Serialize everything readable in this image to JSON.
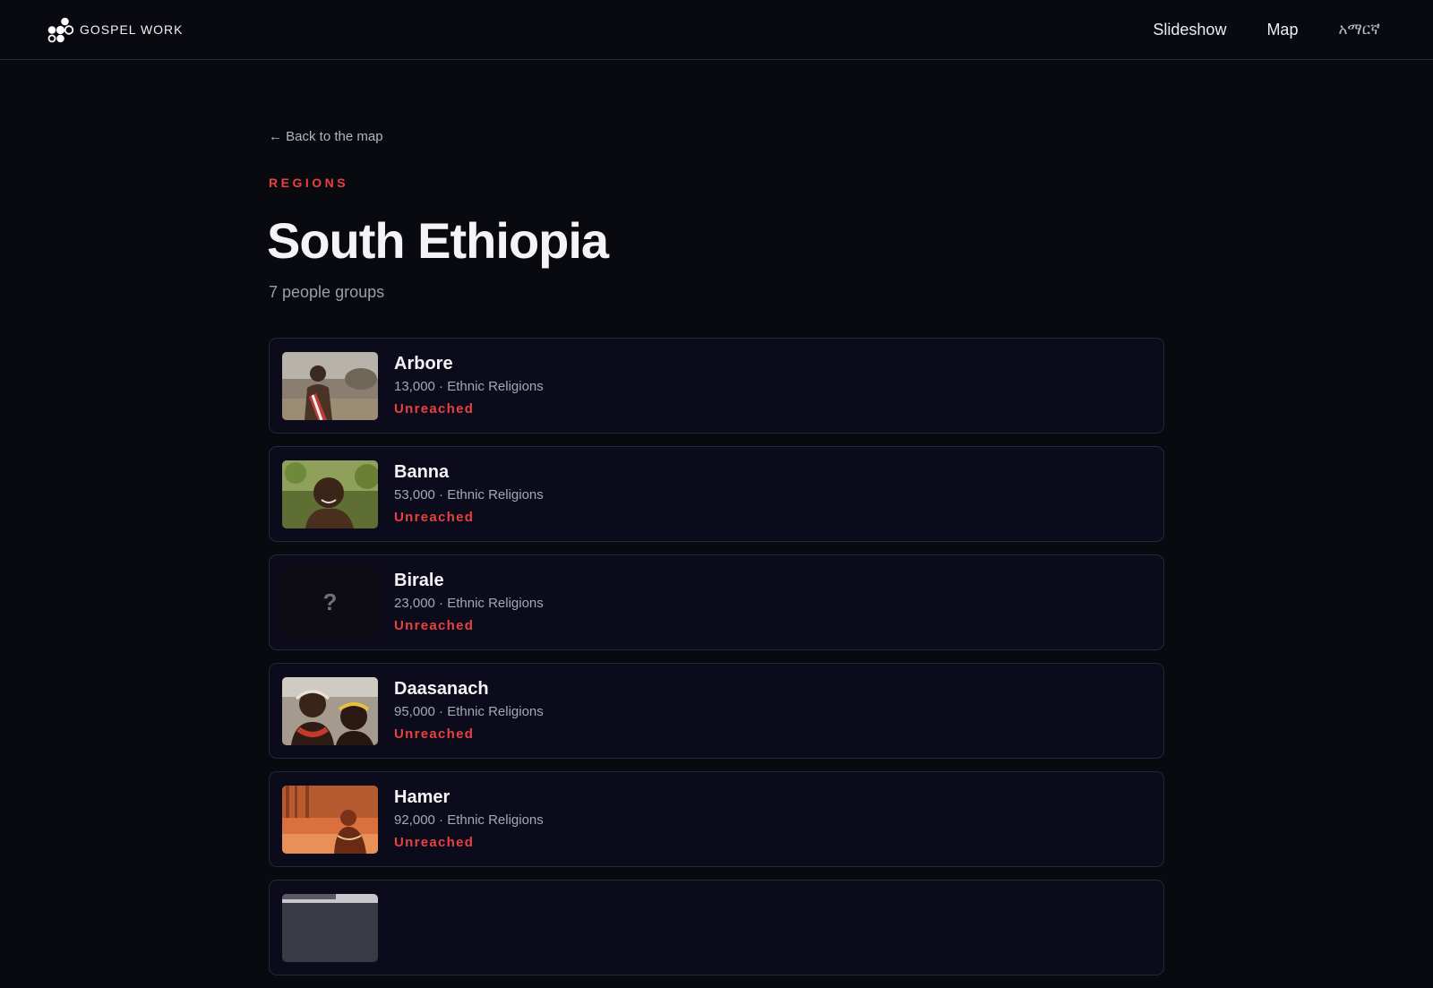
{
  "header": {
    "brand": "GOSPEL WORK",
    "nav": [
      {
        "label": "Slideshow"
      },
      {
        "label": "Map"
      },
      {
        "label": "አማርኛ"
      }
    ]
  },
  "main": {
    "back_label": "← Back to the map",
    "eyebrow": "REGIONS",
    "title": "South Ethiopia",
    "count": "7 people groups",
    "groups": [
      {
        "name": "Arbore",
        "meta": "13,000 · Ethnic Religions",
        "status": "Unreached",
        "has_photo": true
      },
      {
        "name": "Banna",
        "meta": "53,000 · Ethnic Religions",
        "status": "Unreached",
        "has_photo": true
      },
      {
        "name": "Birale",
        "meta": "23,000 · Ethnic Religions",
        "status": "Unreached",
        "has_photo": false,
        "placeholder": "?"
      },
      {
        "name": "Daasanach",
        "meta": "95,000 · Ethnic Religions",
        "status": "Unreached",
        "has_photo": true
      },
      {
        "name": "Hamer",
        "meta": "92,000 · Ethnic Religions",
        "status": "Unreached",
        "has_photo": true
      }
    ]
  },
  "colors": {
    "background": "#090a10",
    "accent": "#e8423f",
    "card": "#0c0b1c"
  }
}
